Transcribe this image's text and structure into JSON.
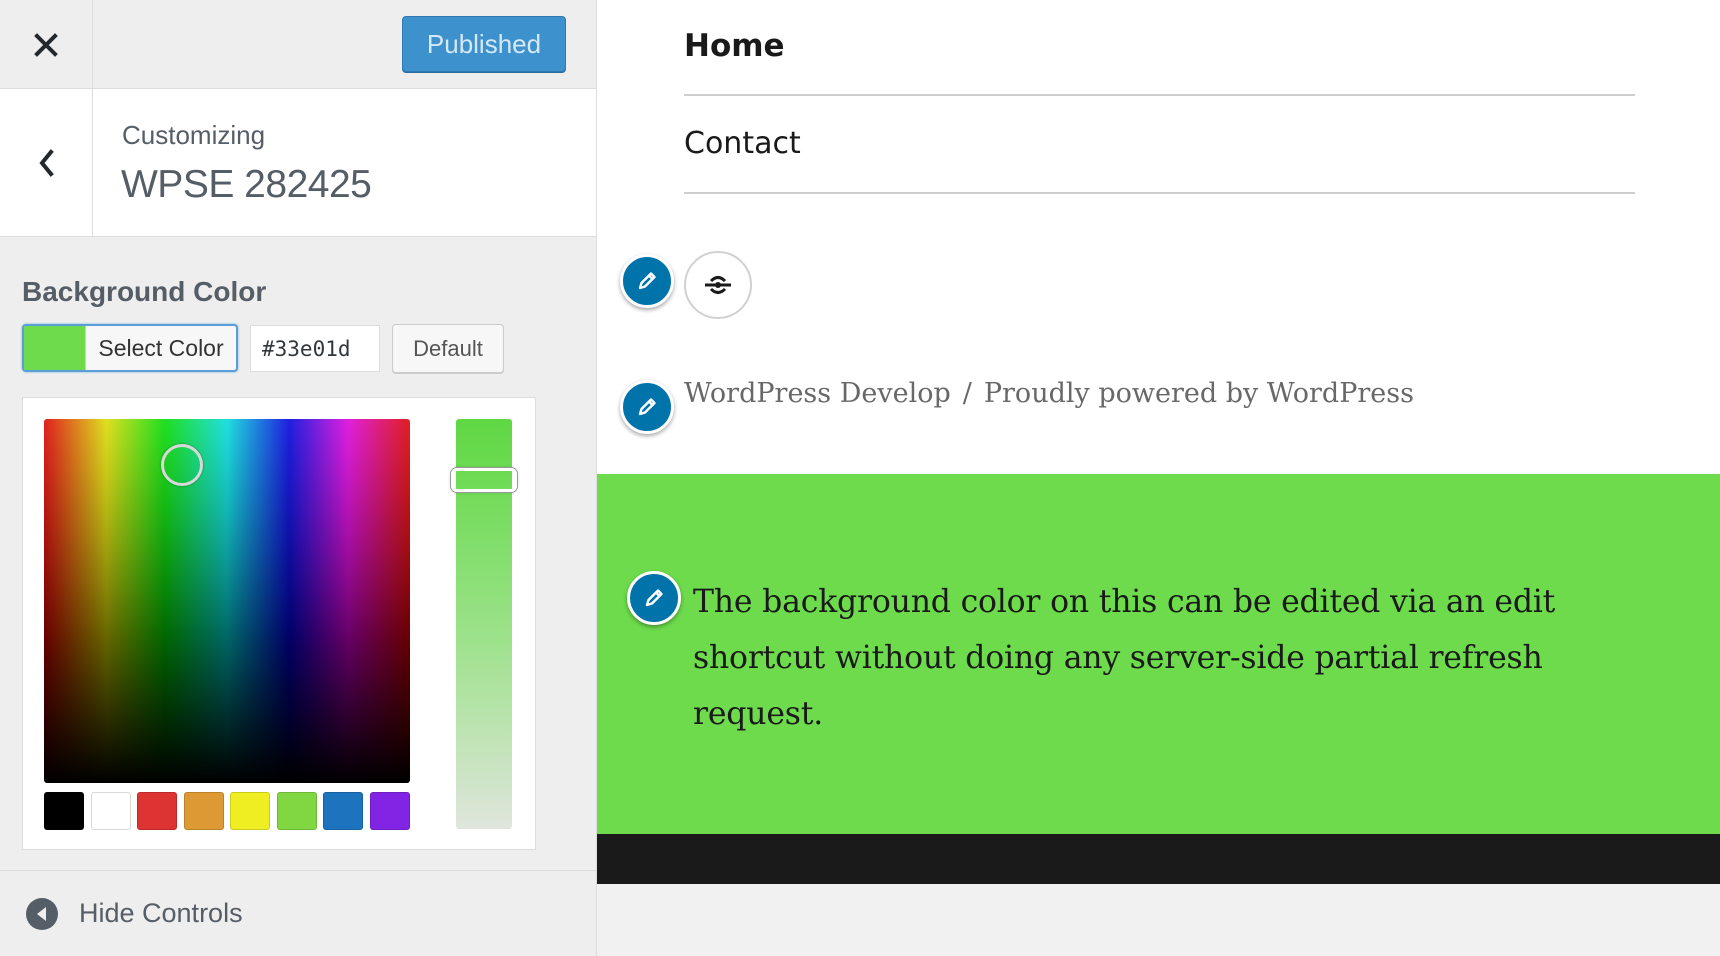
{
  "header": {
    "close_icon": "close-icon",
    "publish_label": "Published",
    "publish_color": "#3d91cd"
  },
  "info": {
    "back_icon": "chevron-left-icon",
    "customizing_label": "Customizing",
    "site_title": "WPSE 282425"
  },
  "control": {
    "title": "Background Color",
    "select_color_label": "Select Color",
    "hex_value": "#33e01d",
    "default_label": "Default",
    "current_color": "#6ddb4c",
    "palette": [
      "#000000",
      "#ffffff",
      "#dd3333",
      "#dd9933",
      "#eeee22",
      "#81d742",
      "#1e73be",
      "#8224e3"
    ]
  },
  "footer": {
    "hide_controls_label": "Hide Controls",
    "hide_icon": "arrow-left-circle-icon"
  },
  "preview": {
    "menu": [
      "Home",
      "Contact"
    ],
    "social_icon": "codepen-icon",
    "credit_site": "WordPress Develop",
    "credit_separator": "/",
    "credit_powered": "Proudly powered by WordPress",
    "green_text": "The background color on this can be edited via an edit shortcut without doing any server-side partial refresh request.",
    "edit_icon": "pencil-icon"
  }
}
